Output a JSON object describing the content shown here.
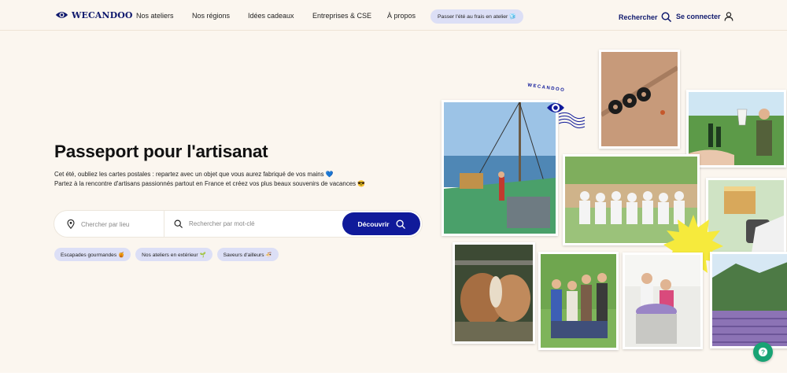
{
  "header": {
    "brand": "WECANDOO",
    "nav": [
      "Nos ateliers",
      "Nos régions",
      "Idées cadeaux",
      "Entreprises & CSE",
      "À propos"
    ],
    "promo": "Passer l'été au frais en atelier 🧊",
    "search_label": "Rechercher",
    "login_label": "Se connecter"
  },
  "hero": {
    "title": "Passeport pour l'artisanat",
    "desc1": "Cet été, oubliez les cartes postales : repartez avec un objet que vous aurez fabriqué de vos mains 💙",
    "desc2": "Partez à la rencontre d'artisans passionnés partout en France et créez vos plus beaux souvenirs de vacances 😎"
  },
  "search": {
    "place_placeholder": "Chercher par lieu",
    "keyword_placeholder": "Rechercher par mot-clé",
    "button": "Découvrir"
  },
  "chips": [
    "Escapades gourmandes 🍯",
    "Nos ateliers en extérieur 🌱",
    "Saveurs d'ailleurs 🍜"
  ],
  "stamp": {
    "text": "WECANDOO"
  },
  "colors": {
    "brand": "#101a9a",
    "background": "#fbf6ef",
    "chip": "#dcdff6",
    "sun": "#f6ea3c",
    "help": "#18a374"
  },
  "icons": [
    "location-pin-icon",
    "search-icon",
    "user-icon",
    "help-icon"
  ]
}
